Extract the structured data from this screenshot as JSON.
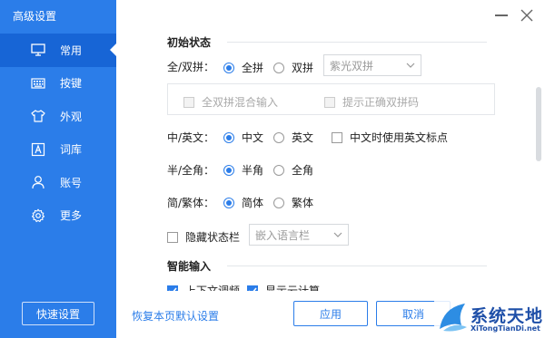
{
  "window": {
    "title": "高级设置"
  },
  "sidebar": {
    "items": [
      {
        "label": "常用",
        "icon": "monitor-icon",
        "active": true
      },
      {
        "label": "按键",
        "icon": "keyboard-icon",
        "active": false
      },
      {
        "label": "外观",
        "icon": "shirt-icon",
        "active": false
      },
      {
        "label": "词库",
        "icon": "dictionary-icon",
        "active": false
      },
      {
        "label": "账号",
        "icon": "user-icon",
        "active": false
      },
      {
        "label": "更多",
        "icon": "gear-icon",
        "active": false
      }
    ],
    "quick_settings": "快速设置",
    "colors": {
      "bg": "#2b7de9",
      "active_bg": "#1765d6"
    }
  },
  "sections": {
    "initial": "初始状态",
    "smart": "智能输入"
  },
  "pinyin": {
    "label": "全/双拼：",
    "full": "全拼",
    "double": "双拼",
    "scheme": "紫光双拼",
    "mixed": "全双拼混合输入",
    "hint": "提示正确双拼码",
    "selected": "全拼"
  },
  "lang": {
    "label": "中/英文：",
    "cn": "中文",
    "en": "英文",
    "en_punct": "中文时使用英文标点",
    "selected": "中文"
  },
  "width": {
    "label": "半/全角：",
    "half": "半角",
    "full": "全角",
    "selected": "半角"
  },
  "script": {
    "label": "简/繁体：",
    "simp": "简体",
    "trad": "繁体",
    "selected": "简体"
  },
  "statusbar": {
    "hide": "隐藏状态栏",
    "embed": "嵌入语言栏"
  },
  "smart": {
    "context": "上下文调频",
    "cloud": "显示云计算"
  },
  "footer": {
    "restore": "恢复本页默认设置",
    "apply": "应用",
    "cancel": "取消"
  },
  "watermark": {
    "cn": "系统天地",
    "en": "XiTongTianDi.net"
  }
}
